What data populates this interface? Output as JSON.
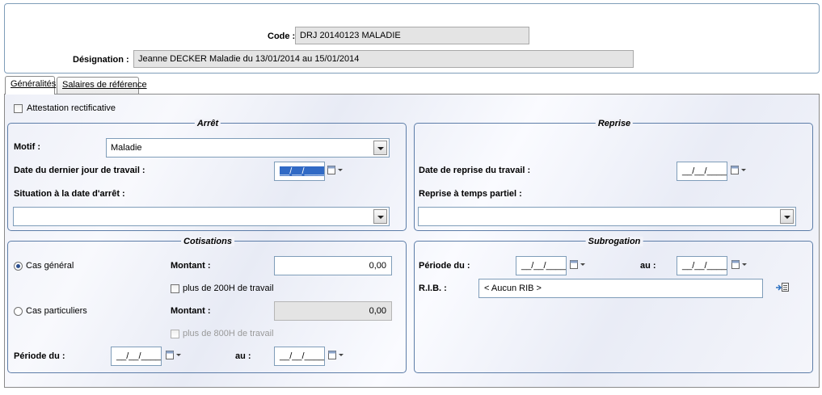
{
  "header": {
    "code_label": "Code :",
    "code_value": "DRJ 20140123 MALADIE",
    "designation_label": "Désignation :",
    "designation_value": "Jeanne DECKER Maladie du 13/01/2014 au 15/01/2014"
  },
  "tabs": [
    {
      "label": "Généralités",
      "active": true
    },
    {
      "label": "Salaires de référence",
      "active": false
    }
  ],
  "attestation": {
    "label": "Attestation rectificative",
    "checked": false
  },
  "arret": {
    "title": "Arrêt",
    "motif_label": "Motif :",
    "motif_value": "Maladie",
    "dernier_jour_label": "Date du dernier jour de travail :",
    "dernier_jour_value": "__/__/____",
    "situation_label": "Situation à la date d'arrêt :",
    "situation_value": ""
  },
  "reprise": {
    "title": "Reprise",
    "date_label": "Date de reprise du travail :",
    "date_value": "__/__/____",
    "temps_partiel_label": "Reprise à temps partiel :",
    "temps_partiel_value": ""
  },
  "cotisations": {
    "title": "Cotisations",
    "cas_general_label": "Cas général",
    "cas_general_selected": true,
    "montant_label": "Montant :",
    "montant_general_value": "0,00",
    "plus_200h_label": "plus de 200H de travail",
    "cas_particuliers_label": "Cas particuliers",
    "montant_particuliers_label": "Montant :",
    "montant_particuliers_value": "0,00",
    "plus_800h_label": "plus de 800H de travail",
    "periode_label": "Période du :",
    "periode_du_value": "__/__/____",
    "au_label": "au :",
    "periode_au_value": "__/__/____"
  },
  "subrogation": {
    "title": "Subrogation",
    "periode_label": "Période du :",
    "periode_du_value": "__/__/____",
    "au_label": "au :",
    "periode_au_value": "__/__/____",
    "rib_label": "R.I.B. :",
    "rib_value": "< Aucun RIB >"
  },
  "icons": [
    "calendar-icon",
    "dropdown-arrow-icon",
    "rib-select-icon"
  ]
}
